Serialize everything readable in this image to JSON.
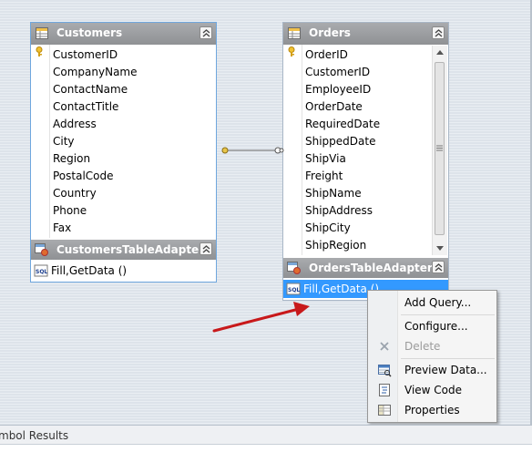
{
  "customers": {
    "title": "Customers",
    "fields": [
      "CustomerID",
      "CompanyName",
      "ContactName",
      "ContactTitle",
      "Address",
      "City",
      "Region",
      "PostalCode",
      "Country",
      "Phone",
      "Fax"
    ],
    "key_field_index": 0,
    "adapter": {
      "title": "CustomersTableAdapter",
      "methods": [
        "Fill,GetData ()"
      ]
    }
  },
  "orders": {
    "title": "Orders",
    "fields": [
      "OrderID",
      "CustomerID",
      "EmployeeID",
      "OrderDate",
      "RequiredDate",
      "ShippedDate",
      "ShipVia",
      "Freight",
      "ShipName",
      "ShipAddress",
      "ShipCity",
      "ShipRegion"
    ],
    "key_field_index": 0,
    "adapter": {
      "title": "OrdersTableAdapter",
      "methods": [
        "Fill,GetData ()"
      ]
    }
  },
  "context_menu": {
    "items": [
      {
        "label": "Add Query...",
        "icon": "none",
        "enabled": true
      },
      {
        "separator": true
      },
      {
        "label": "Configure...",
        "icon": "none",
        "enabled": true
      },
      {
        "label": "Delete",
        "icon": "delete-icon",
        "enabled": false
      },
      {
        "separator": true
      },
      {
        "label": "Preview Data...",
        "icon": "preview-data-icon",
        "enabled": true
      },
      {
        "label": "View Code",
        "icon": "view-code-icon",
        "enabled": true
      },
      {
        "label": "Properties",
        "icon": "properties-icon",
        "enabled": true
      }
    ]
  },
  "status_bar": {
    "text": "mbol Results"
  },
  "colors": {
    "header_bg": "#999b9e",
    "selected_bg": "#3399ff",
    "arrow": "#c8191b",
    "selected_border": "#6fa7de"
  }
}
